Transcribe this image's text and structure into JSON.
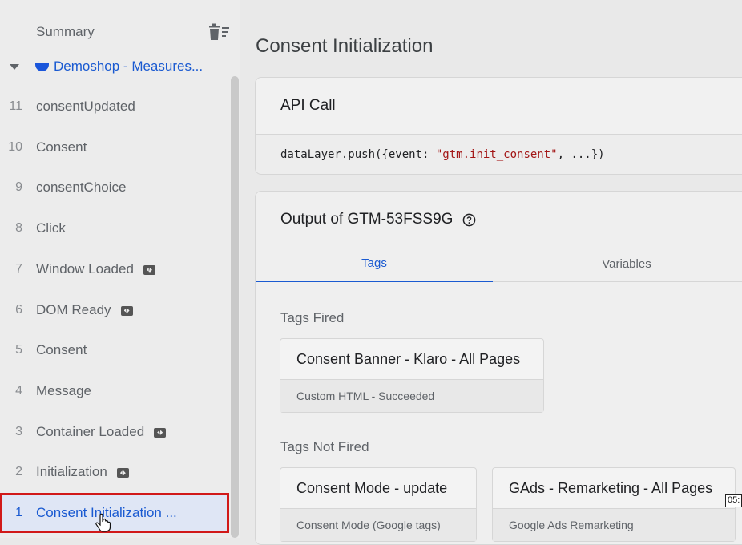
{
  "sidebar": {
    "header": "Summary",
    "container": "Demoshop - Measures...",
    "events": [
      {
        "num": "11",
        "label": "consentUpdated",
        "badge": false
      },
      {
        "num": "10",
        "label": "Consent",
        "badge": false
      },
      {
        "num": "9",
        "label": "consentChoice",
        "badge": false
      },
      {
        "num": "8",
        "label": "Click",
        "badge": false
      },
      {
        "num": "7",
        "label": "Window Loaded",
        "badge": true
      },
      {
        "num": "6",
        "label": "DOM Ready",
        "badge": true
      },
      {
        "num": "5",
        "label": "Consent",
        "badge": false
      },
      {
        "num": "4",
        "label": "Message",
        "badge": false
      },
      {
        "num": "3",
        "label": "Container Loaded",
        "badge": true
      },
      {
        "num": "2",
        "label": "Initialization",
        "badge": true
      },
      {
        "num": "1",
        "label": "Consent Initialization ...",
        "badge": false,
        "selected": true
      }
    ]
  },
  "main": {
    "title": "Consent Initialization",
    "api_call": {
      "heading": "API Call",
      "code_prefix": "dataLayer.push({event: ",
      "code_string": "\"gtm.init_consent\"",
      "code_suffix": ", ...})"
    },
    "output": {
      "heading": "Output of GTM-53FSS9G",
      "tabs": {
        "tags": "Tags",
        "variables": "Variables"
      },
      "tags_fired_label": "Tags Fired",
      "tags_fired": [
        {
          "name": "Consent Banner - Klaro - All Pages",
          "status": "Custom HTML - Succeeded"
        }
      ],
      "tags_not_fired_label": "Tags Not Fired",
      "tags_not_fired": [
        {
          "name": "Consent Mode - update",
          "type": "Consent Mode (Google tags)"
        },
        {
          "name": "GAds - Remarketing - All Pages",
          "type": "Google Ads Remarketing"
        }
      ]
    }
  },
  "overlay": {
    "timestamp": "05:"
  },
  "colors": {
    "accent": "#1a5ad1",
    "selection_outline": "#d11919"
  }
}
